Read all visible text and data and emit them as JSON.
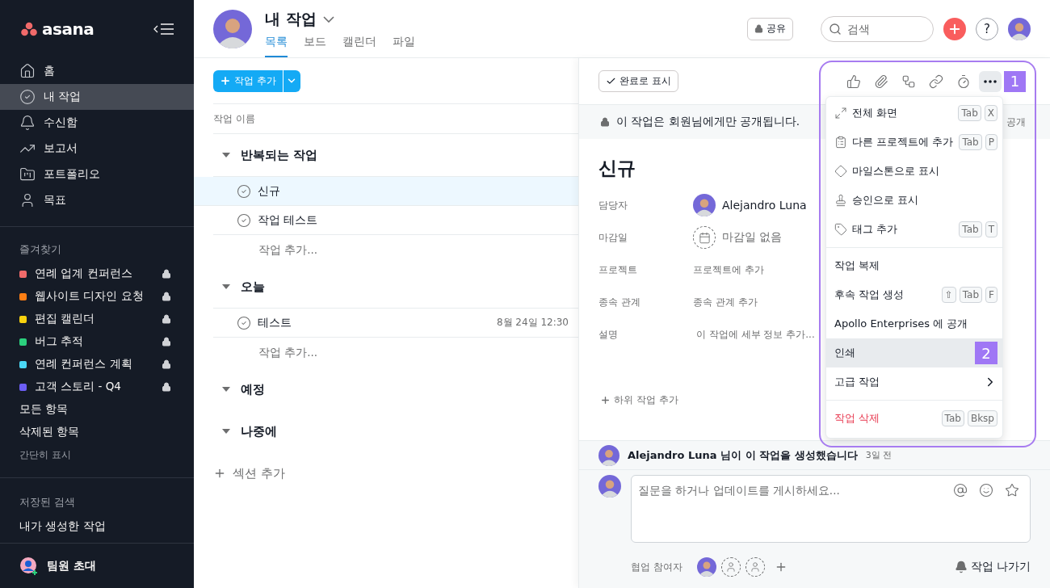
{
  "sidebar": {
    "logo": "asana",
    "nav": [
      {
        "label": "홈",
        "selected": false
      },
      {
        "label": "내 작업",
        "selected": true
      },
      {
        "label": "수신함",
        "selected": false
      },
      {
        "label": "보고서",
        "selected": false
      },
      {
        "label": "포트폴리오",
        "selected": false
      },
      {
        "label": "목표",
        "selected": false
      }
    ],
    "favorites_title": "즐겨찾기",
    "favorites": [
      {
        "label": "연례 업계 컨퍼런스",
        "color": "#f06a6a",
        "locked": true
      },
      {
        "label": "웹사이트 디자인 요청",
        "color": "#fd7e14",
        "locked": true
      },
      {
        "label": "편집 캘린더",
        "color": "#f8d20e",
        "locked": true
      },
      {
        "label": "버그 추적",
        "color": "#2bd07d",
        "locked": true
      },
      {
        "label": "연례 컨퍼런스 계획",
        "color": "#4ad8f5",
        "locked": true
      },
      {
        "label": "고객 스토리 - Q4",
        "color": "#6c5ef5",
        "locked": true
      }
    ],
    "links": [
      "모든 항목",
      "삭제된 항목"
    ],
    "collapse": "간단히 표시",
    "saved_title": "저장된 검색",
    "saved": [
      "내가 생성한 작업"
    ],
    "invite": "팀원 초대"
  },
  "header": {
    "title": "내 작업",
    "tabs": [
      {
        "label": "목록",
        "selected": true
      },
      {
        "label": "보드",
        "selected": false
      },
      {
        "label": "캘린더",
        "selected": false
      },
      {
        "label": "파일",
        "selected": false
      }
    ],
    "share": "공유",
    "search": {
      "placeholder": "검색"
    },
    "help": "?"
  },
  "list": {
    "add_button": "작업 추가",
    "column": "작업 이름",
    "sections": [
      {
        "title": "반복되는 작업",
        "expanded": true,
        "tasks": [
          {
            "name": "신규",
            "selected": true
          },
          {
            "name": "작업 테스트",
            "selected": false
          }
        ],
        "add": "작업 추가..."
      },
      {
        "title": "오늘",
        "expanded": true,
        "tasks": [
          {
            "name": "테스트",
            "date": "8월 24일 12:30",
            "selected": false
          }
        ],
        "add": "작업 추가..."
      },
      {
        "title": "예정",
        "expanded": true
      },
      {
        "title": "나중에",
        "expanded": true
      }
    ],
    "add_section": "섹션 추가"
  },
  "detail": {
    "complete_button": "완료로 표시",
    "toolbar_badge": "1",
    "banner": "이 작업은 회원님에게만 공개됩니다.",
    "banner_action": "공개",
    "title": "신규",
    "fields": [
      {
        "label": "담당자",
        "value": "Alejandro Luna",
        "kind": "person"
      },
      {
        "label": "마감일",
        "value": "마감일 없음",
        "kind": "date"
      },
      {
        "label": "프로젝트",
        "value": "프로젝트에 추가",
        "kind": "text"
      },
      {
        "label": "종속 관계",
        "value": "종속 관계 추가",
        "kind": "text"
      },
      {
        "label": "설명",
        "value": "이 작업에 세부 정보 추가...",
        "kind": "description"
      }
    ],
    "add_subtask": "하위 작업 추가",
    "activity": {
      "text": "Alejandro Luna 님이 이 작업을 생성했습니다",
      "time": "3일 전"
    },
    "comment": {
      "placeholder": "질문을 하거나 업데이트를 게시하세요..."
    },
    "collaborators_label": "협업 참여자",
    "leave": "작업 나가기"
  },
  "menu": {
    "groups": [
      [
        {
          "label": "전체 화면",
          "keys": [
            "Tab",
            "X"
          ],
          "kind": "item",
          "selected": false
        },
        {
          "label": "다른 프로젝트에 추가",
          "keys": [
            "Tab",
            "P"
          ],
          "kind": "item",
          "selected": false
        },
        {
          "label": "마일스톤으로 표시",
          "kind": "item",
          "selected": false
        },
        {
          "label": "승인으로 표시",
          "kind": "item",
          "selected": false
        },
        {
          "label": "태그 추가",
          "keys": [
            "Tab",
            "T"
          ],
          "kind": "item",
          "selected": false
        }
      ],
      [
        {
          "label": "작업 복제",
          "kind": "item",
          "selected": false
        },
        {
          "label": "후속 작업 생성",
          "keys": [
            "⇧",
            "Tab",
            "F"
          ],
          "kind": "item",
          "selected": false
        },
        {
          "label": "Apollo Enterprises 에 공개",
          "kind": "item",
          "selected": false
        },
        {
          "label": "인쇄",
          "kind": "item",
          "selected": true,
          "badge": "2"
        },
        {
          "label": "고급 작업",
          "kind": "submenu",
          "selected": false
        }
      ],
      [
        {
          "label": "작업 삭제",
          "keys": [
            "Tab",
            "Bksp"
          ],
          "kind": "danger",
          "selected": false
        }
      ]
    ]
  }
}
